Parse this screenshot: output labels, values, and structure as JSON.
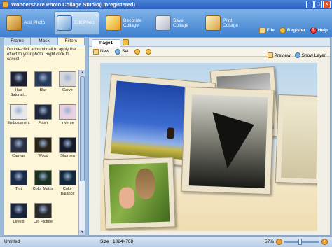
{
  "window": {
    "title": "Wondershare Photo Collage Studio(Unregistered)"
  },
  "toolbar": {
    "buttons": [
      {
        "label": "Add Photo",
        "icon": "add-photo-icon"
      },
      {
        "label": "Edit Photo",
        "icon": "edit-photo-icon",
        "active": true
      },
      {
        "label": "Decorate Collage",
        "icon": "decorate-icon"
      },
      {
        "label": "Save Collage",
        "icon": "save-icon"
      },
      {
        "label": "Print Collage",
        "icon": "print-icon"
      }
    ],
    "links": [
      {
        "label": "File",
        "icon": "file-icon"
      },
      {
        "label": "Register",
        "icon": "register-icon"
      },
      {
        "label": "Help",
        "icon": "help-icon"
      }
    ]
  },
  "left_panel": {
    "tabs": [
      "Frame",
      "Mask",
      "Filters"
    ],
    "active_tab": "Filters",
    "hint": "Double-click a thumbnail to apply the effect to your photo. Right click to cancel.",
    "filters": [
      {
        "label": "Hue Saturati...",
        "color": "#1c2030"
      },
      {
        "label": "Blur",
        "color": "#2a3b5a"
      },
      {
        "label": "Carve",
        "color": "#d8d8d8"
      },
      {
        "label": "Embossment",
        "color": "#e8e8e8"
      },
      {
        "label": "Flash",
        "color": "#20283c"
      },
      {
        "label": "Inverse",
        "color": "#e8d0e0"
      },
      {
        "label": "Canvas",
        "color": "#2a3040"
      },
      {
        "label": "Wood",
        "color": "#2a2418"
      },
      {
        "label": "Sharpen",
        "color": "#141a28"
      },
      {
        "label": "Tint",
        "color": "#1a2a44"
      },
      {
        "label": "Color Matrix",
        "color": "#1a3020"
      },
      {
        "label": "Color Balance",
        "color": "#12283a"
      },
      {
        "label": "Levels",
        "color": "#1a2438"
      },
      {
        "label": "Old Picture",
        "color": "#2a2a2a"
      }
    ]
  },
  "canvas": {
    "page_tab": "Page1",
    "tools": {
      "new": "New",
      "set": "Set"
    },
    "right_tools": {
      "preview": "Preview",
      "show_layer": "Show Layer"
    }
  },
  "status": {
    "file": "Untitled",
    "size": "Size : 1024×768",
    "zoom": "57%"
  }
}
